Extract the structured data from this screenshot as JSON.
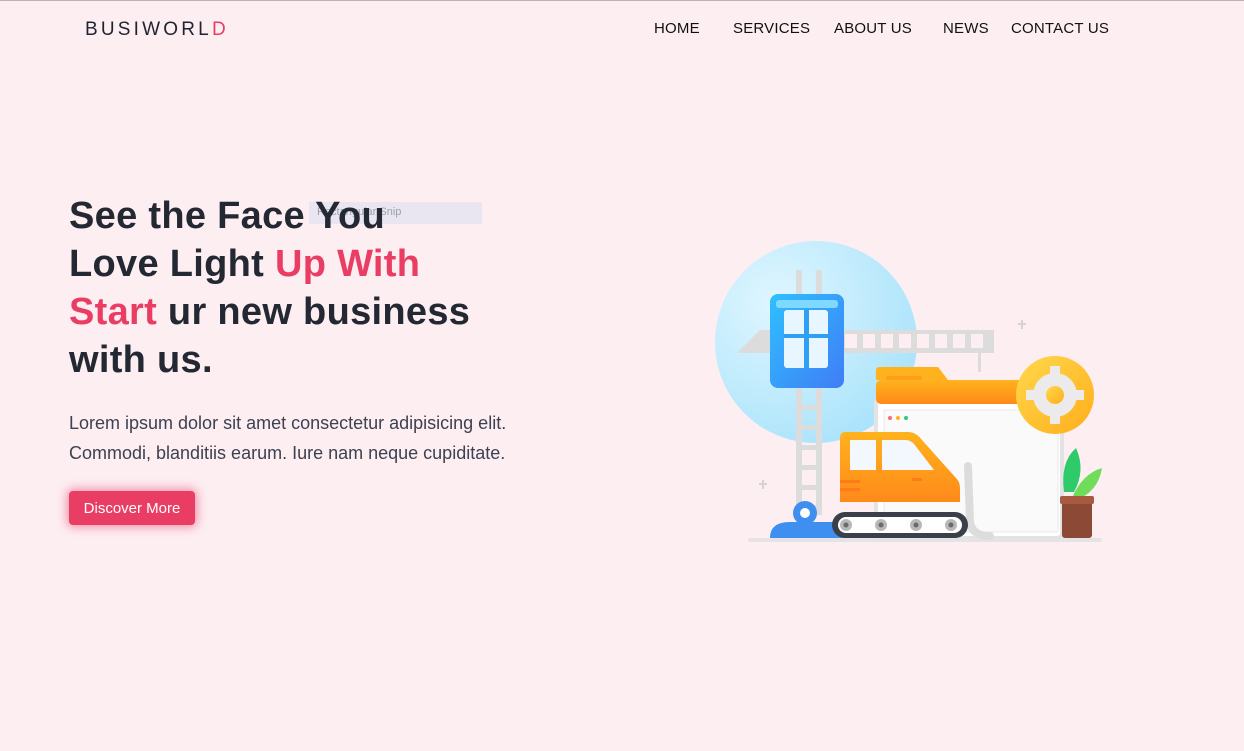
{
  "brand": {
    "main": "BUSIWORL",
    "accent": "D"
  },
  "nav": {
    "items": [
      "HOME",
      "SERVICES",
      "ABOUT US",
      "NEWS",
      "CONTACT US"
    ]
  },
  "hero": {
    "title_line1": "See the Face You",
    "title_line2_dark": "Love Light ",
    "title_line2_pink": "Up With",
    "title_line3_pink": "Start",
    "title_line3_dark": " ur new business",
    "title_line4": "with us.",
    "snip_badge": "Rectangular Snip",
    "desc_line1": "Lorem ipsum dolor sit amet consectetur adipisicing elit.",
    "desc_line2": "Commodi, blanditiis earum. Iure nam neque cupiditate.",
    "cta_label": "Discover More"
  },
  "colors": {
    "accent": "#ea3d64",
    "background": "#fdeef2",
    "text": "#232833"
  },
  "icons": {
    "illustration": "construction-illustration"
  }
}
